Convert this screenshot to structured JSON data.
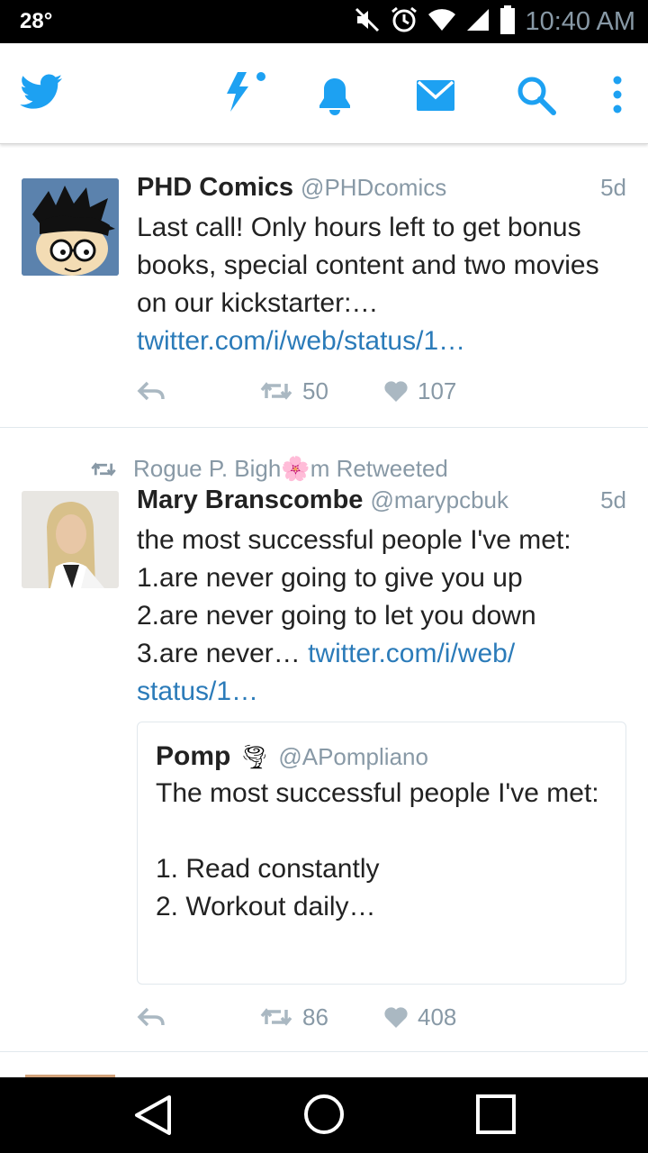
{
  "status_bar": {
    "temperature": "28°",
    "time": "10:40 AM"
  },
  "app_bar": {
    "accent_color": "#1da1f2",
    "icons": [
      "twitter-bird-icon",
      "moments-lightning-icon",
      "notifications-bell-icon",
      "messages-envelope-icon",
      "search-icon",
      "overflow-menu-icon"
    ]
  },
  "tweets": [
    {
      "name": "PHD Comics",
      "handle": "@PHDcomics",
      "time": "5d",
      "text": "Last call! Only hours left to get bonus books, special content and two movies on our kickstarter:…",
      "link": "twitter.com/i/web/status/1…",
      "retweets": "50",
      "likes": "107"
    },
    {
      "retweeted_by": "Rogue P. Bigh🌸m Retweeted",
      "name": "Mary Branscombe",
      "handle": "@marypcbuk",
      "time": "5d",
      "lines": [
        "the most successful people I've met:",
        "1.are never going to give you up",
        "2.are never going to let you down"
      ],
      "last_line_text": "3.are never… ",
      "link_part1": "twitter.com/i/web/",
      "link_part2": "status/1…",
      "quoted": {
        "name": "Pomp",
        "emoji": "🌪",
        "handle": "@APompliano",
        "text": "The most successful people I've met:\n\n1. Read constantly\n2. Workout daily…"
      },
      "retweets": "86",
      "likes": "408"
    }
  ]
}
